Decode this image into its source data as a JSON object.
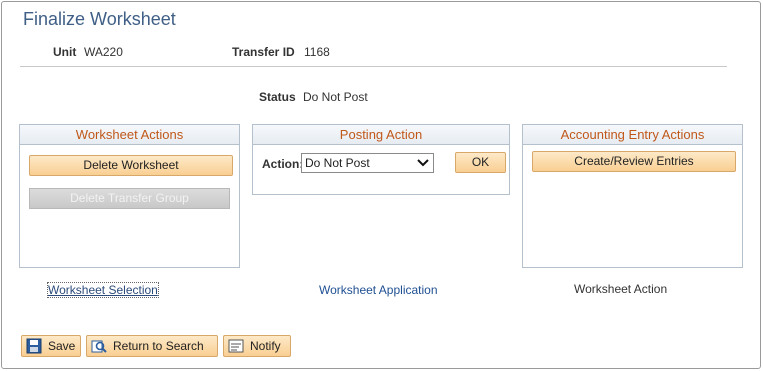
{
  "page": {
    "title": "Finalize Worksheet"
  },
  "header": {
    "unit_label": "Unit",
    "unit_value": "WA220",
    "transfer_label": "Transfer ID",
    "transfer_value": "1168",
    "status_label": "Status",
    "status_value": "Do Not Post"
  },
  "worksheet_actions": {
    "title": "Worksheet Actions",
    "delete_worksheet": "Delete Worksheet",
    "delete_transfer_group": "Delete Transfer Group"
  },
  "posting_action": {
    "title": "Posting Action",
    "action_label": "Action:",
    "selected": "Do Not Post",
    "ok_label": "OK"
  },
  "accounting_entry_actions": {
    "title": "Accounting Entry Actions",
    "create_review": "Create/Review Entries"
  },
  "links": {
    "worksheet_selection": "Worksheet Selection",
    "worksheet_application": "Worksheet Application",
    "worksheet_action": "Worksheet Action"
  },
  "toolbar": {
    "save": "Save",
    "return_to_search": "Return to Search",
    "notify": "Notify"
  },
  "colors": {
    "title_blue": "#3f5f86",
    "section_orange": "#c0581a",
    "button_orange": "#f9cf92",
    "link_blue": "#1f4f93"
  },
  "icons": [
    "save-icon",
    "search-return-icon",
    "notify-icon",
    "chevron-down-icon"
  ]
}
